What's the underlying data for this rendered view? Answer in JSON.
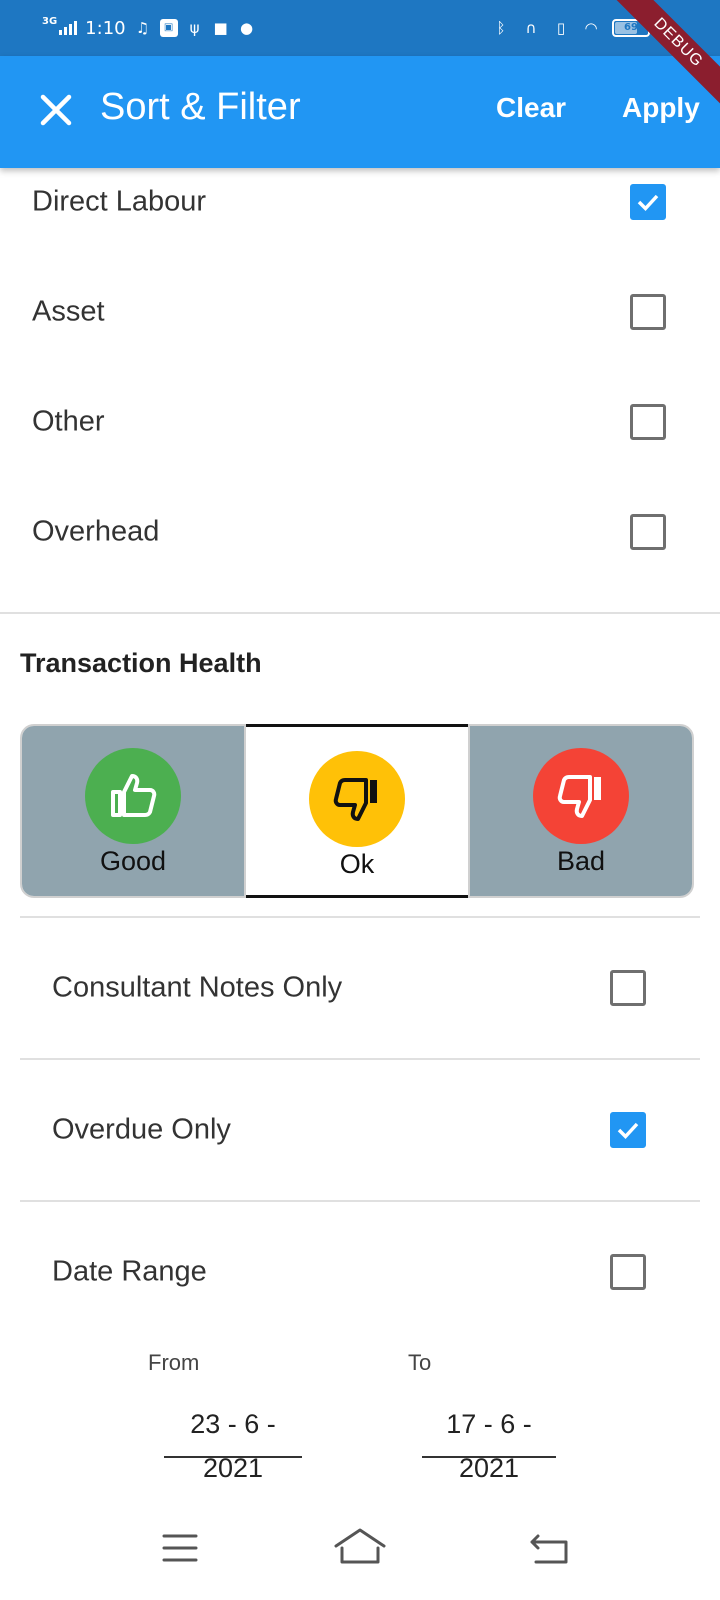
{
  "status_bar": {
    "network_type": "3G",
    "time": "1:10",
    "battery_level": "69"
  },
  "debug_banner": "DEBUG",
  "app_bar": {
    "title": "Sort & Filter",
    "clear_label": "Clear",
    "apply_label": "Apply"
  },
  "categories": [
    {
      "label": "Direct Labour",
      "checked": true
    },
    {
      "label": "Asset",
      "checked": false
    },
    {
      "label": "Other",
      "checked": false
    },
    {
      "label": "Overhead",
      "checked": false
    }
  ],
  "transaction_health": {
    "title": "Transaction Health",
    "options": [
      {
        "label": "Good",
        "color": "#4CAF50",
        "icon": "thumbs-up-icon",
        "selected": false
      },
      {
        "label": "Ok",
        "color": "#FFC107",
        "icon": "thumbs-down-icon",
        "selected": true
      },
      {
        "label": "Bad",
        "color": "#F44336",
        "icon": "thumbs-down-icon",
        "selected": false
      }
    ]
  },
  "options": [
    {
      "label": "Consultant Notes Only",
      "checked": false
    },
    {
      "label": "Overdue Only",
      "checked": true
    },
    {
      "label": "Date Range",
      "checked": false
    }
  ],
  "date_range": {
    "from_label": "From",
    "from_value": "23 - 6 - 2021",
    "to_label": "To",
    "to_value": "17 - 6 - 2021"
  },
  "colors": {
    "primary": "#2196F3",
    "status_bar": "#1E77C2",
    "toggle_unselected": "#90A4AE"
  }
}
